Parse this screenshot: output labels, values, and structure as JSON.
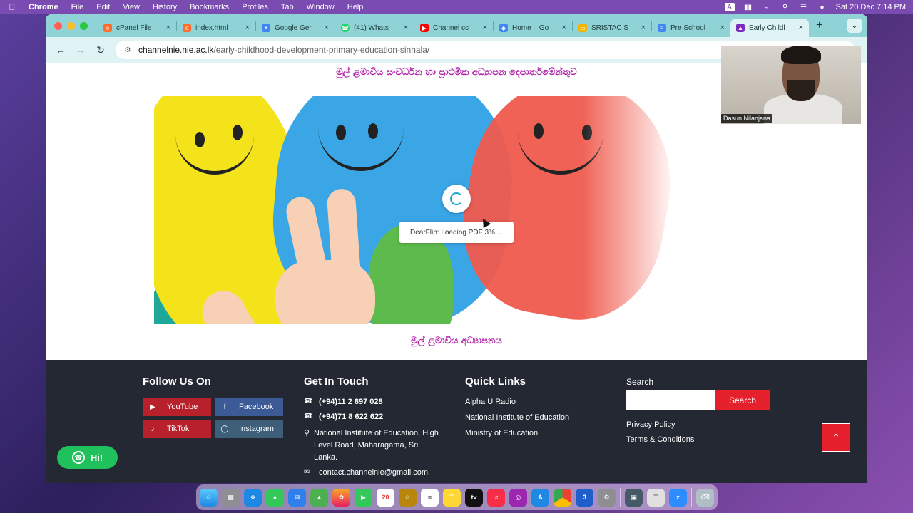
{
  "menubar": {
    "app_name": "Chrome",
    "items": [
      "File",
      "Edit",
      "View",
      "History",
      "Bookmarks",
      "Profiles",
      "Tab",
      "Window",
      "Help"
    ],
    "datetime": "Sat 20 Dec  7:14 PM"
  },
  "tabs": [
    {
      "label": "cPanel File",
      "icon": "cpanel-icon",
      "color": "#ff6c2c"
    },
    {
      "label": "index.html",
      "icon": "cpanel-icon",
      "color": "#ff6c2c"
    },
    {
      "label": "Google Ger",
      "icon": "google-icon",
      "color": "#4285f4"
    },
    {
      "label": "(41) Whats",
      "icon": "whatsapp-icon",
      "color": "#25d366"
    },
    {
      "label": "Channel cc",
      "icon": "youtube-icon",
      "color": "#ff0000"
    },
    {
      "label": "Home – Go",
      "icon": "google-sites-icon",
      "color": "#4285f4"
    },
    {
      "label": "SRISTAC S",
      "icon": "slides-icon",
      "color": "#f4b400"
    },
    {
      "label": "Pre School",
      "icon": "docs-icon",
      "color": "#4285f4"
    },
    {
      "label": "Early Childl",
      "icon": "nie-icon",
      "color": "#7b2cbf",
      "active": true
    }
  ],
  "address": {
    "host": "channelnie.nie.ac.lk",
    "path": "/early-childhood-development-primary-education-sinhala/"
  },
  "page": {
    "heading": "මුල් ළමාවිය සංවර්ධන හා ප්‍රාථමික අධ්‍යාපන දෙපාර්තමේන්තුව",
    "loading_text": "DearFlip: Loading PDF 3% ...",
    "caption": "මුල් ළමාවිය අධ්‍යාපනය"
  },
  "footer": {
    "follow_title": "Follow Us On",
    "social": [
      {
        "label": "YouTube",
        "icon": "youtube-icon"
      },
      {
        "label": "Facebook",
        "icon": "facebook-icon"
      },
      {
        "label": "TikTok",
        "icon": "tiktok-icon"
      },
      {
        "label": "Instagram",
        "icon": "instagram-icon"
      }
    ],
    "contact_title": "Get In Touch",
    "phone1": "(+94)11 2 897 028",
    "phone2": "(+94)71 8 622 622",
    "address": "National Institute of Education, High Level Road, Maharagama, Sri Lanka.",
    "email": "contact.channelnie@gmail.com",
    "links_title": "Quick Links",
    "links": [
      "Alpha U Radio",
      "National Institute of Education",
      "Ministry of Education"
    ],
    "search_label": "Search",
    "search_button": "Search",
    "privacy": "Privacy Policy",
    "terms": "Terms & Conditions"
  },
  "whatsapp_chat": {
    "label": "Hi!"
  },
  "video_call": {
    "participant": "Dasun Nilanjana"
  },
  "dock": {
    "date_badge": "20"
  }
}
